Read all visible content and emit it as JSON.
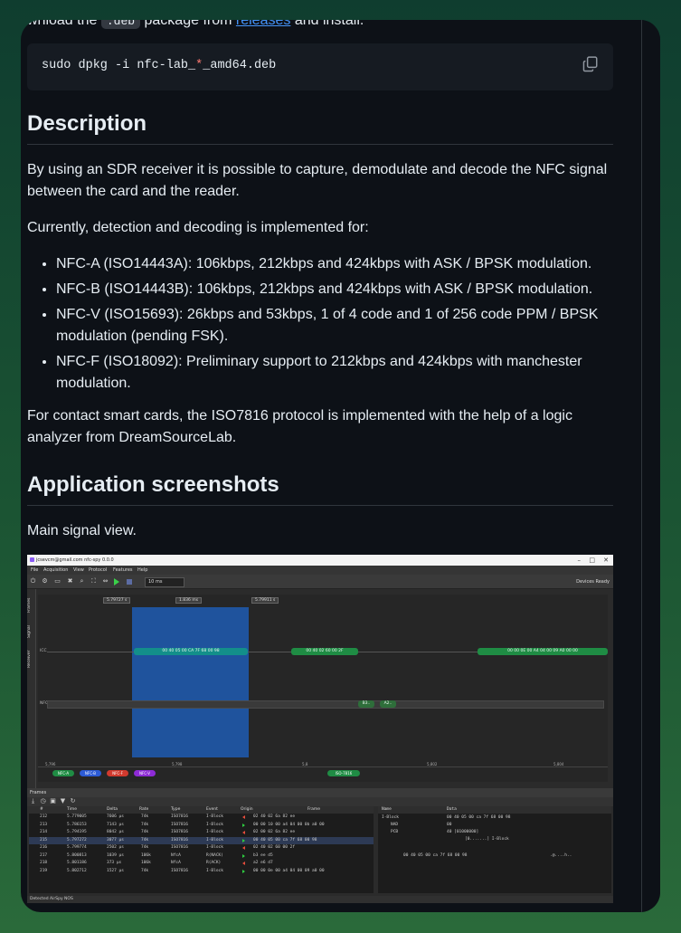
{
  "readme": {
    "cut_line": {
      "pre": "wnload the ",
      "code": ".deb",
      "mid": " package from ",
      "link": "releases",
      "post": " and install:"
    },
    "code_block": {
      "pre": "sudo dpkg -i nfc-lab_",
      "wild": "*",
      "post": "_amd64.deb"
    },
    "description": {
      "heading": "Description",
      "p1": "By using an SDR receiver it is possible to capture, demodulate and decode the NFC signal between the card and the reader.",
      "p2": "Currently, detection and decoding is implemented for:",
      "items": [
        "NFC-A (ISO14443A): 106kbps, 212kbps and 424kbps with ASK / BPSK modulation.",
        "NFC-B (ISO14443B): 106kbps, 212kbps and 424kbps with ASK / BPSK modulation.",
        "NFC-V (ISO15693): 26kbps and 53kbps, 1 of 4 code and 1 of 256 code PPM / BPSK modulation (pending FSK).",
        "NFC-F (ISO18092): Preliminary support to 212kbps and 424kbps with manchester modulation."
      ],
      "p3": "For contact smart cards, the ISO7816 protocol is implemented with the help of a logic analyzer from DreamSourceLab."
    },
    "screenshots": {
      "heading": "Application screenshots",
      "caption": "Main signal view."
    }
  },
  "app": {
    "title": "jcsevcm@gmail.com nfc-spy 0.0.0",
    "window_controls": [
      "–",
      "□",
      "✕"
    ],
    "menu": [
      "File",
      "Acquisition",
      "View",
      "Protocol",
      "Features",
      "Help"
    ],
    "zoom_combo": "10 ms",
    "status": "Devices Ready",
    "side_tabs": [
      "Frames",
      "Signal",
      "Receiver"
    ],
    "ruler": {
      "left": "5.79727 s",
      "mid": "1.836 ms",
      "right": "5.79911 s"
    },
    "rows": {
      "icc": "ICC",
      "nfc": "NFC"
    },
    "frames_signal": {
      "f1": "00 40 05 00 CA 7F 68 00 98",
      "f2": "00 40 02 60 00 2F",
      "f3": "00 00 0E 00 A4 04 00 09 A0 00 00",
      "f4": "B3..",
      "f5": "A2.."
    },
    "axis": [
      "5,796",
      "5,798",
      "5,8",
      "5,802",
      "5,804"
    ],
    "protocols": [
      {
        "label": "NFC-A",
        "color": "#1f8c44"
      },
      {
        "label": "NFC-B",
        "color": "#2c5bd6"
      },
      {
        "label": "NFC-F",
        "color": "#d13a2e"
      },
      {
        "label": "NFC-V",
        "color": "#8e2bd6"
      },
      {
        "label": "ISO-7816",
        "color": "#1f8c44"
      }
    ],
    "frames_panel": "Frames",
    "table": {
      "headers": [
        "#",
        "Time",
        "Delta",
        "Rate",
        "Type",
        "Event",
        "Origin",
        "Frame"
      ],
      "rows": [
        [
          "212",
          "5.779005",
          "7606 µs",
          "74k",
          "ISO7816",
          "I-Block",
          "tx",
          "02 40 02 6a 82 ee"
        ],
        [
          "213",
          "5.786153",
          "7143 µs",
          "74k",
          "ISO7816",
          "I-Block",
          "rx",
          "00 00 10 00 a4 04 00 0b a0 00"
        ],
        [
          "214",
          "5.794195",
          "8042 µs",
          "74k",
          "ISO7816",
          "I-Block",
          "tx",
          "02 00 02 6a 82 ee"
        ],
        [
          "215",
          "5.797272",
          "3077 µs",
          "74k",
          "ISO7816",
          "I-Block",
          "rx",
          "00 40 05 00 ca 7f 68 00 98"
        ],
        [
          "216",
          "5.799774",
          "2502 µs",
          "74k",
          "ISO7816",
          "I-Block",
          "tx",
          "02 40 02 60 00 2f"
        ],
        [
          "217",
          "5.800813",
          "1039 µs",
          "106k",
          "NfcA",
          "R(NACK)",
          "rx",
          "b3 ee d5"
        ],
        [
          "218",
          "5.801186",
          "373 µs",
          "106k",
          "NfcA",
          "R(ACK)",
          "tx",
          "a2 e6 d7"
        ],
        [
          "219",
          "5.802712",
          "1527 µs",
          "74k",
          "ISO7816",
          "I-Block",
          "rx",
          "00 00 0e 00 a4 04 00 09 a0 00"
        ]
      ]
    },
    "detail": {
      "headers": [
        "Name",
        "Data"
      ],
      "lines": [
        {
          "name": "I-Block",
          "data": "00 40 05 00 ca 7f 68 00 98"
        },
        {
          "name": "NAD",
          "data": "00"
        },
        {
          "name": "PCB",
          "data": "40 [01000000]"
        },
        {
          "name": "",
          "data": "[0.......] I-Block"
        }
      ],
      "hex": "00 40 05 00 ca 7f 68 00 98",
      "ascii": ".@....h.."
    },
    "statusbar": "Detected AirSpy NOS"
  }
}
